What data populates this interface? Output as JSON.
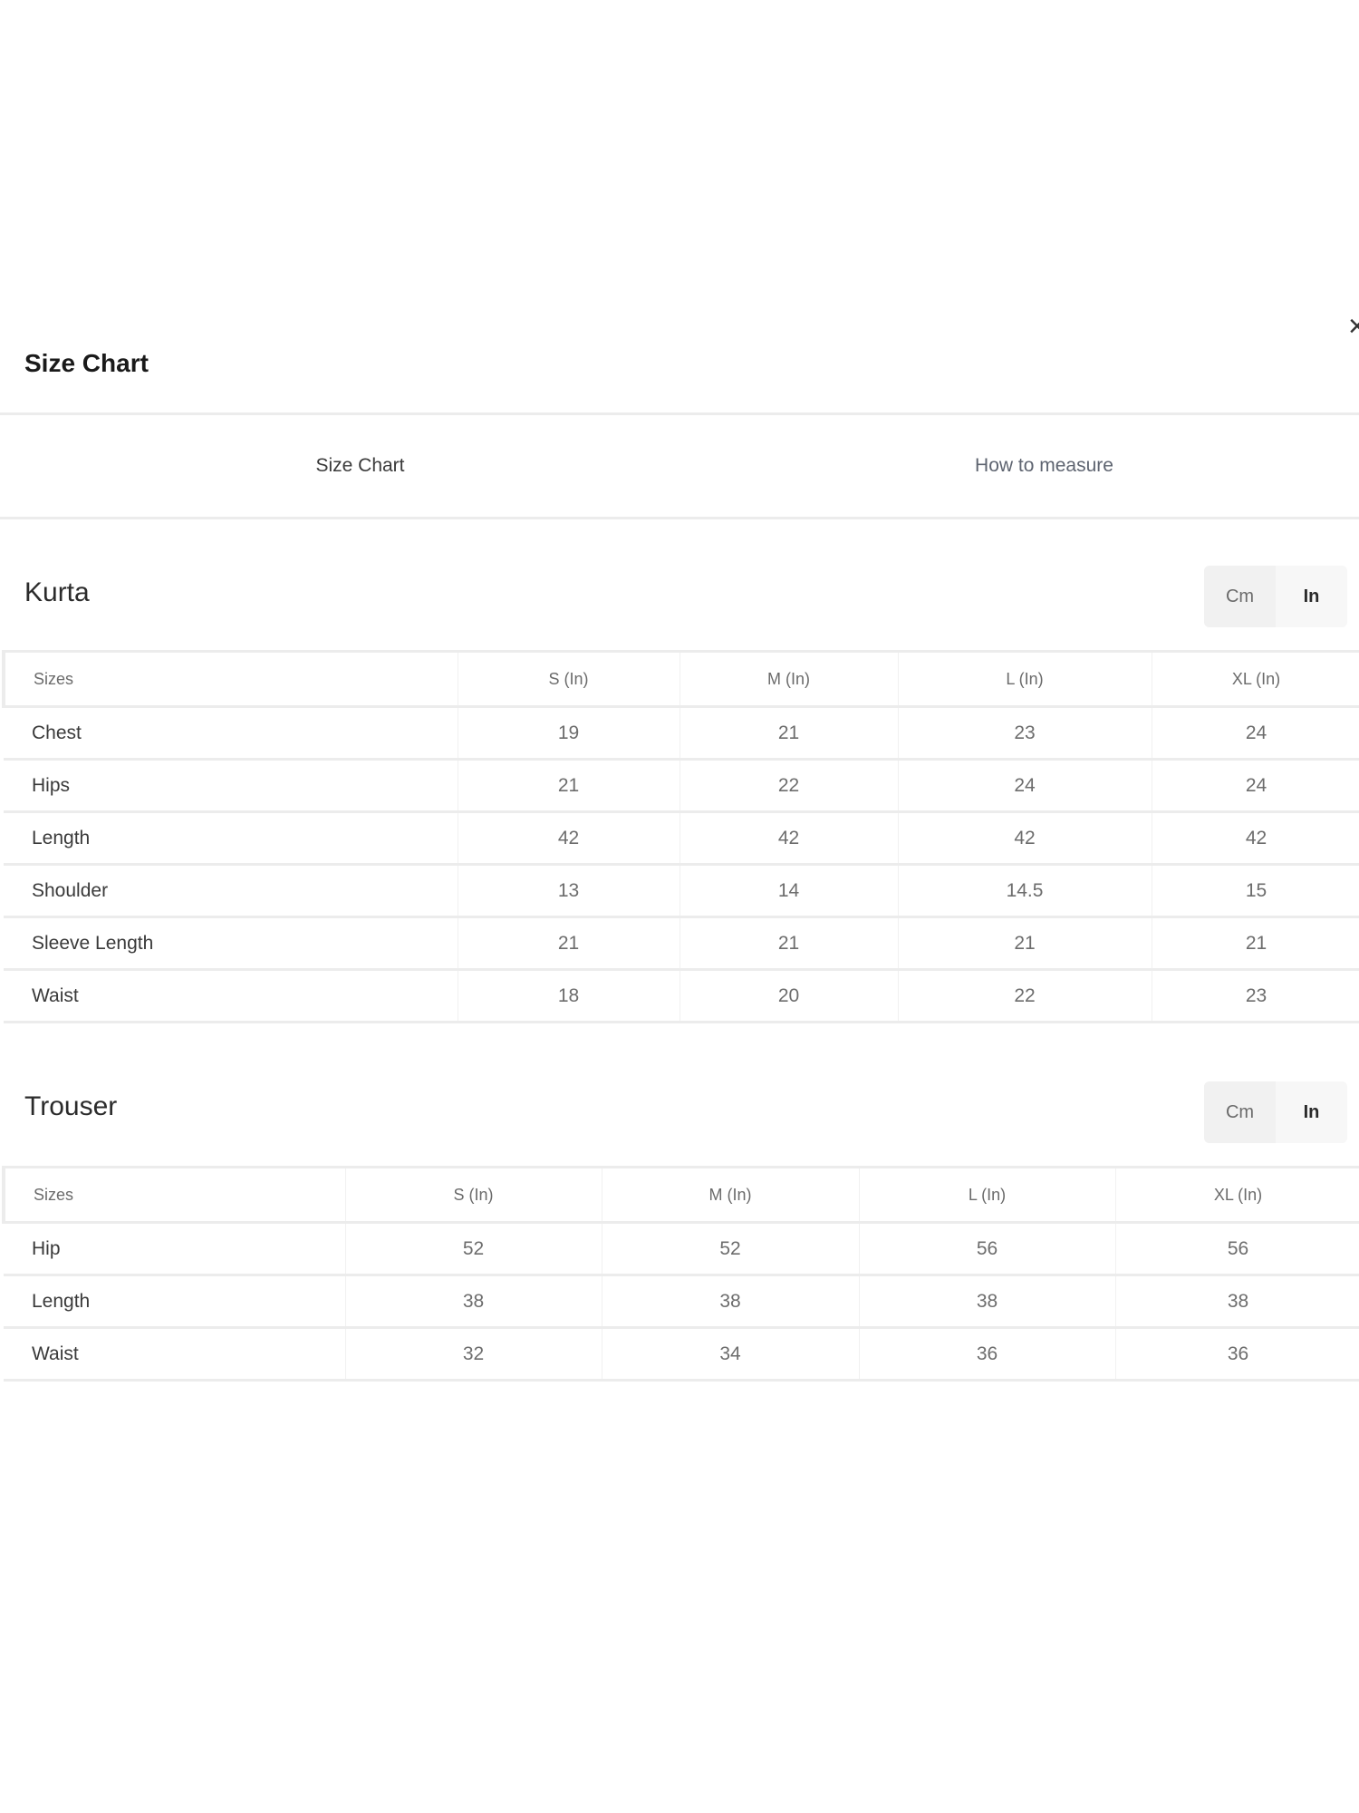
{
  "modal": {
    "title": "Size Chart",
    "close_icon": "×"
  },
  "tabs": [
    {
      "label": "Size Chart",
      "active": true
    },
    {
      "label": "How to measure",
      "active": false
    }
  ],
  "sections": [
    {
      "title": "Kurta",
      "units": {
        "cm": "Cm",
        "in": "In",
        "selected": "In"
      },
      "headers": [
        "Sizes",
        "S (In)",
        "M (In)",
        "L (In)",
        "XL (In)"
      ],
      "rows": [
        [
          "Chest",
          "19",
          "21",
          "23",
          "24"
        ],
        [
          "Hips",
          "21",
          "22",
          "24",
          "24"
        ],
        [
          "Length",
          "42",
          "42",
          "42",
          "42"
        ],
        [
          "Shoulder",
          "13",
          "14",
          "14.5",
          "15"
        ],
        [
          "Sleeve Length",
          "21",
          "21",
          "21",
          "21"
        ],
        [
          "Waist",
          "18",
          "20",
          "22",
          "23"
        ]
      ]
    },
    {
      "title": "Trouser",
      "units": {
        "cm": "Cm",
        "in": "In",
        "selected": "In"
      },
      "headers": [
        "Sizes",
        "S (In)",
        "M (In)",
        "L (In)",
        "XL (In)"
      ],
      "rows": [
        [
          "Hip",
          "52",
          "52",
          "56",
          "56"
        ],
        [
          "Length",
          "38",
          "38",
          "38",
          "38"
        ],
        [
          "Waist",
          "32",
          "34",
          "36",
          "36"
        ]
      ]
    }
  ]
}
